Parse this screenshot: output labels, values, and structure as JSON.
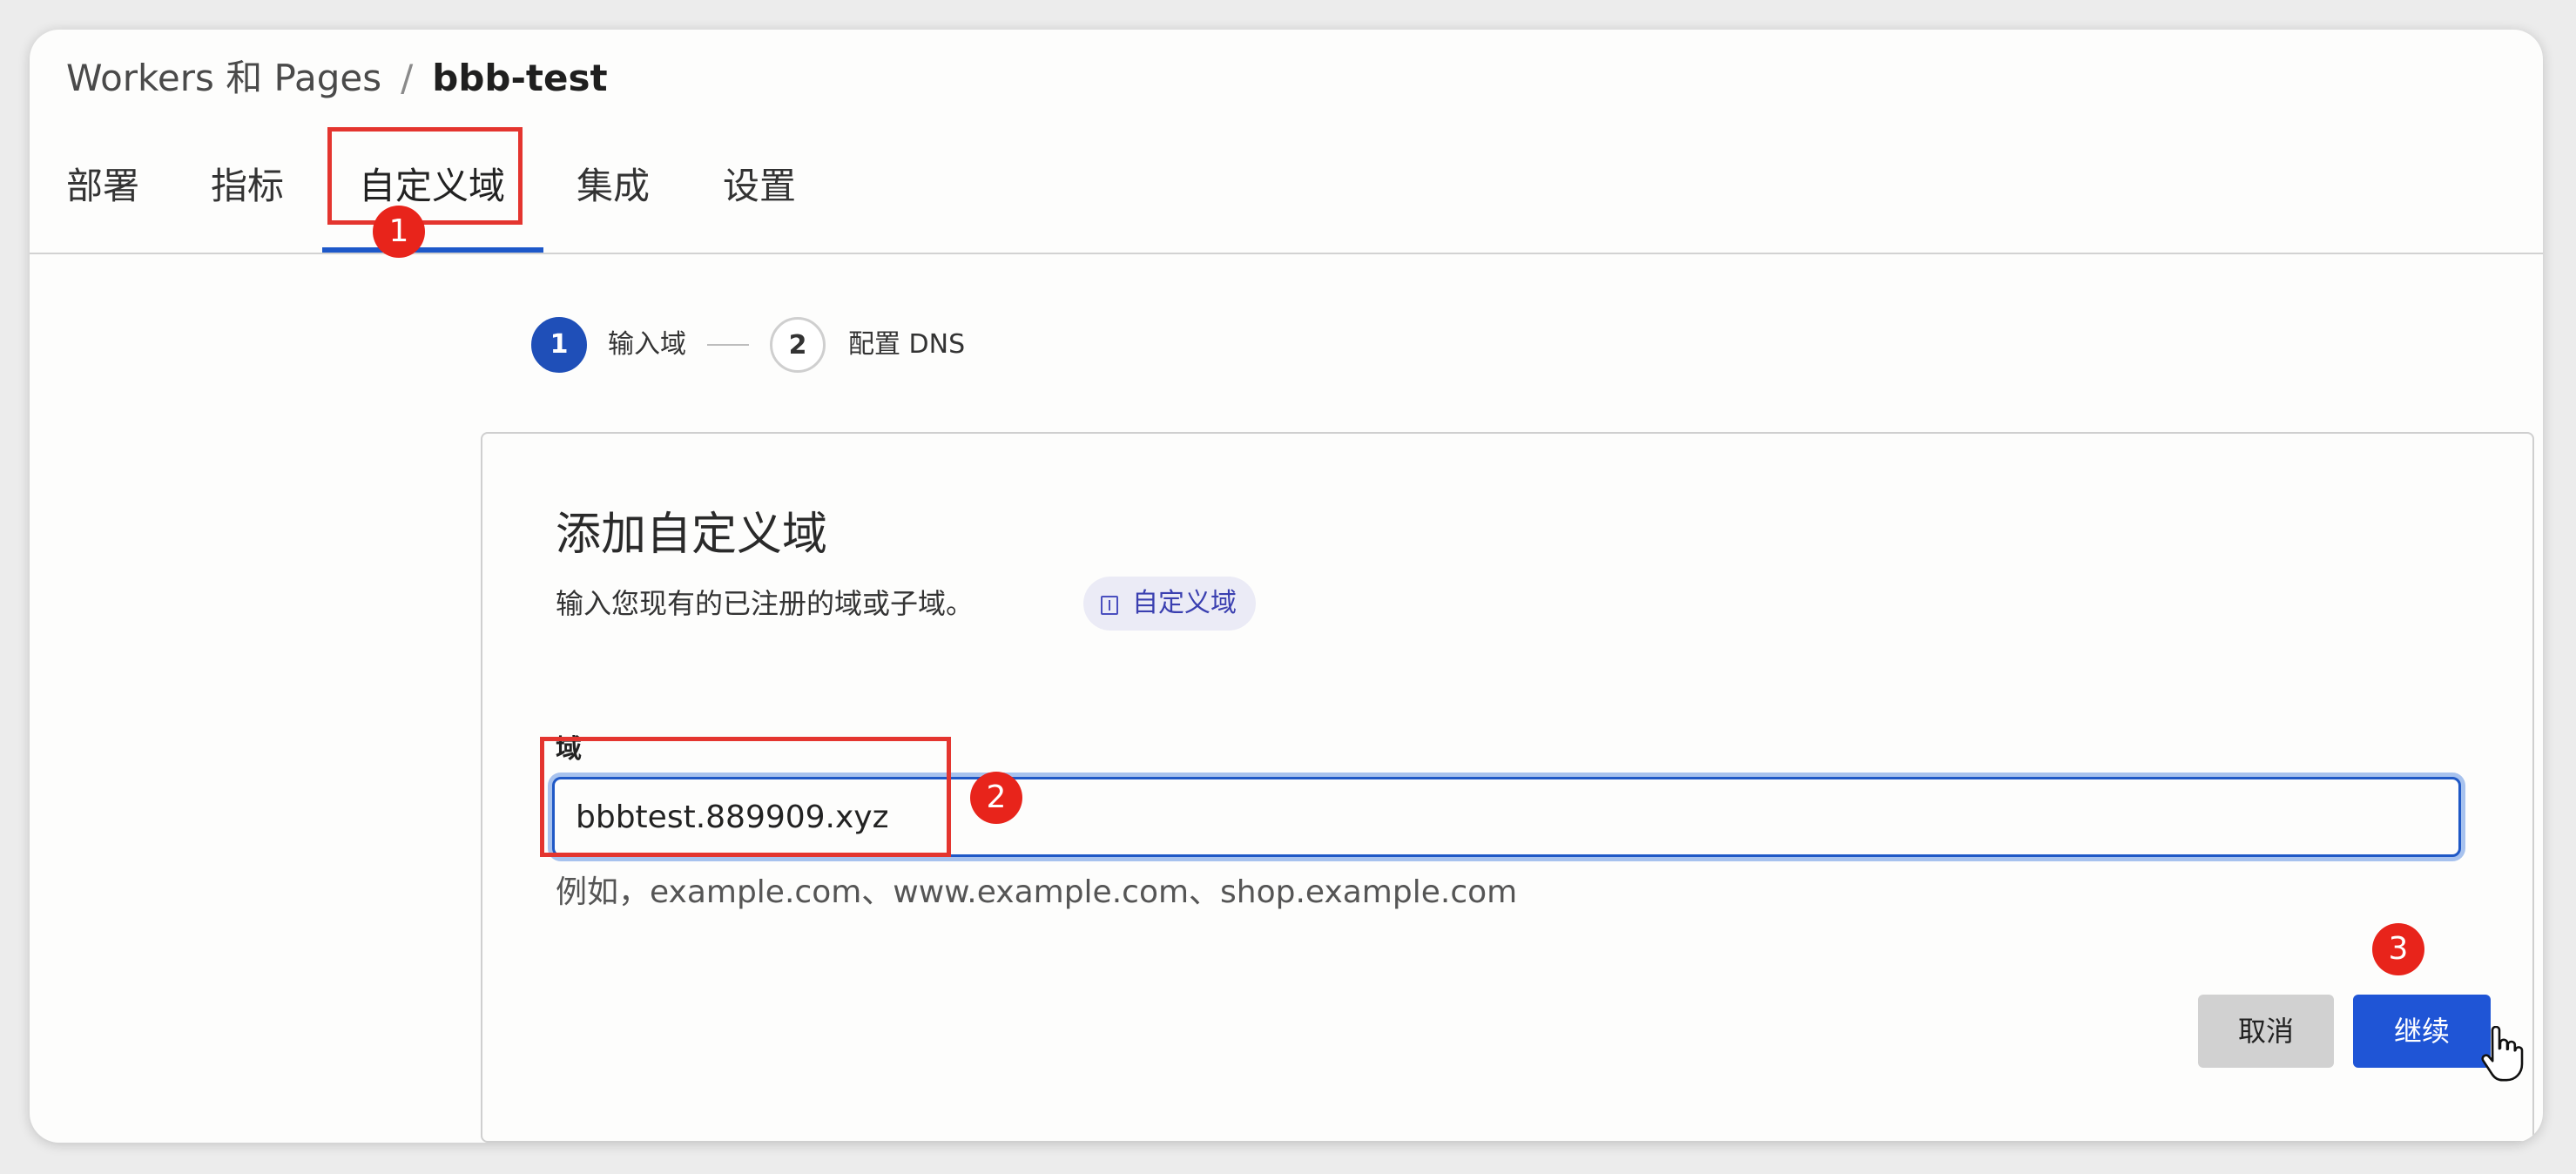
{
  "breadcrumb": {
    "parent": "Workers 和 Pages",
    "separator": "/",
    "current": "bbb-test"
  },
  "tabs": [
    {
      "label": "部署"
    },
    {
      "label": "指标"
    },
    {
      "label": "自定义域"
    },
    {
      "label": "集成"
    },
    {
      "label": "设置"
    }
  ],
  "active_tab": "自定义域",
  "stepper": {
    "steps": [
      {
        "number": "1",
        "label": "输入域"
      },
      {
        "number": "2",
        "label": "配置 DNS"
      }
    ]
  },
  "card": {
    "title": "添加自定义域",
    "description": "输入您现有的已注册的域或子域。",
    "doc_link_label": "自定义域",
    "field_label": "域",
    "field_value": "bbbtest.889909.xyz",
    "field_hint": "例如，example.com、www.example.com、shop.example.com",
    "cancel_label": "取消",
    "continue_label": "继续"
  },
  "annotations": [
    "1",
    "2",
    "3"
  ],
  "colors": {
    "accent": "#1f55d6",
    "annotation": "#e8241b"
  },
  "icons": [
    "doc-icon",
    "hand-pointer-cursor"
  ]
}
